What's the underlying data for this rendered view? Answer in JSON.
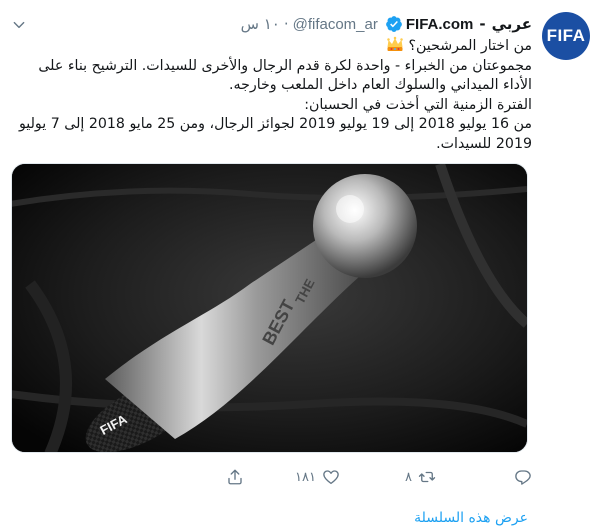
{
  "tweet": {
    "author_name": "عربي",
    "brand_name": "FIFA.com",
    "handle": "@fifacom_ar",
    "time": "١٠ س",
    "avatar_text": "FIFA",
    "lines": [
      "من اختار المرشحين؟",
      "مجموعتان من الخبراء - واحدة لكرة قدم الرجال والأخرى للسيدات. الترشيح بناء على",
      "الأداء الميداني والسلوك العام داخل الملعب وخارجه.",
      "الفترة الزمنية التي أخذت في الحسبان:",
      " من 16 يوليو 2018 إلى 19 يوليو 2019 لجوائز الرجال، ومن 25 مايو 2018 إلى 7 يوليو",
      "2019 للسيدات."
    ],
    "trophy_text_top": "THE",
    "trophy_text_mid": "BEST",
    "trophy_base_text": "FIFA"
  },
  "actions": {
    "reply_count": "",
    "retweet_count": "٨",
    "like_count": "١٨١"
  },
  "thread_link": "عرض هذه السلسلة",
  "icons": {
    "verified": "verified-badge-icon",
    "chevron": "chevron-down-icon",
    "reply": "reply-icon",
    "retweet": "retweet-icon",
    "like": "heart-icon",
    "share": "share-icon",
    "crown": "crown-emoji-icon"
  },
  "colors": {
    "link": "#1da1f2",
    "muted": "#657786",
    "verified": "#1da1f2",
    "avatar_bg": "#1b4fa3"
  }
}
